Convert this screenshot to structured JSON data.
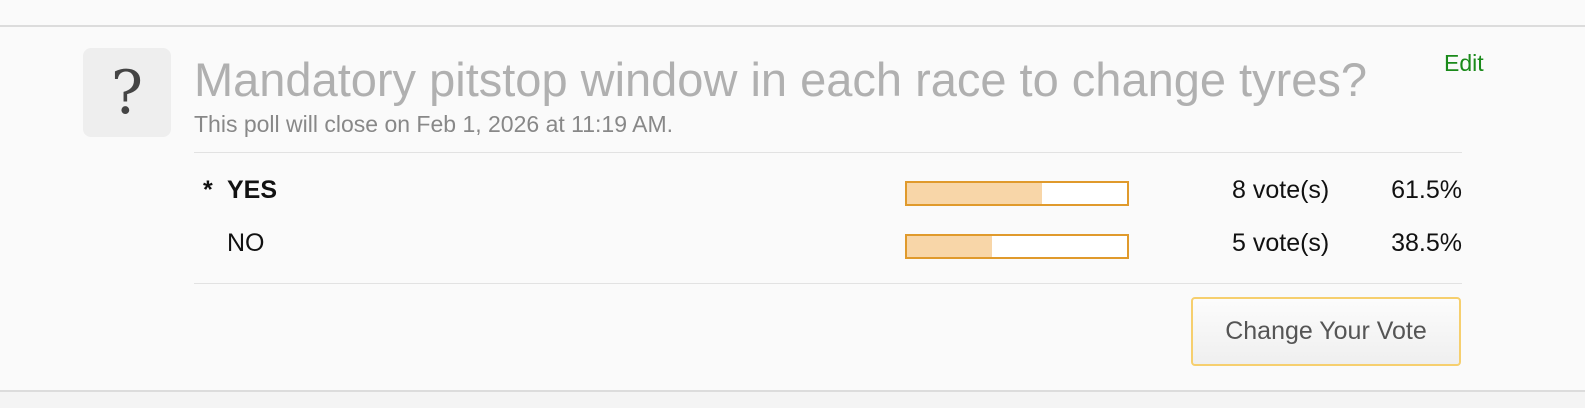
{
  "poll": {
    "icon": "question-mark-icon",
    "icon_glyph": "?",
    "title": "Mandatory pitstop window in each race to change tyres?",
    "subtitle": "This poll will close on Feb 1, 2026 at 11:19 AM.",
    "edit_label": "Edit",
    "options": [
      {
        "marker": "*",
        "label": "YES",
        "selected": true,
        "votes_text": "8 vote(s)",
        "percent_text": "61.5%",
        "fraction": 0.615
      },
      {
        "marker": "",
        "label": "NO",
        "selected": false,
        "votes_text": "5 vote(s)",
        "percent_text": "38.5%",
        "fraction": 0.385
      }
    ],
    "change_vote_label": "Change Your Vote"
  },
  "colors": {
    "bar_border": "#e09a2c",
    "bar_fill": "#f8d6a8",
    "edit_link": "#1a8a1a",
    "button_border": "#f6cf6e"
  }
}
